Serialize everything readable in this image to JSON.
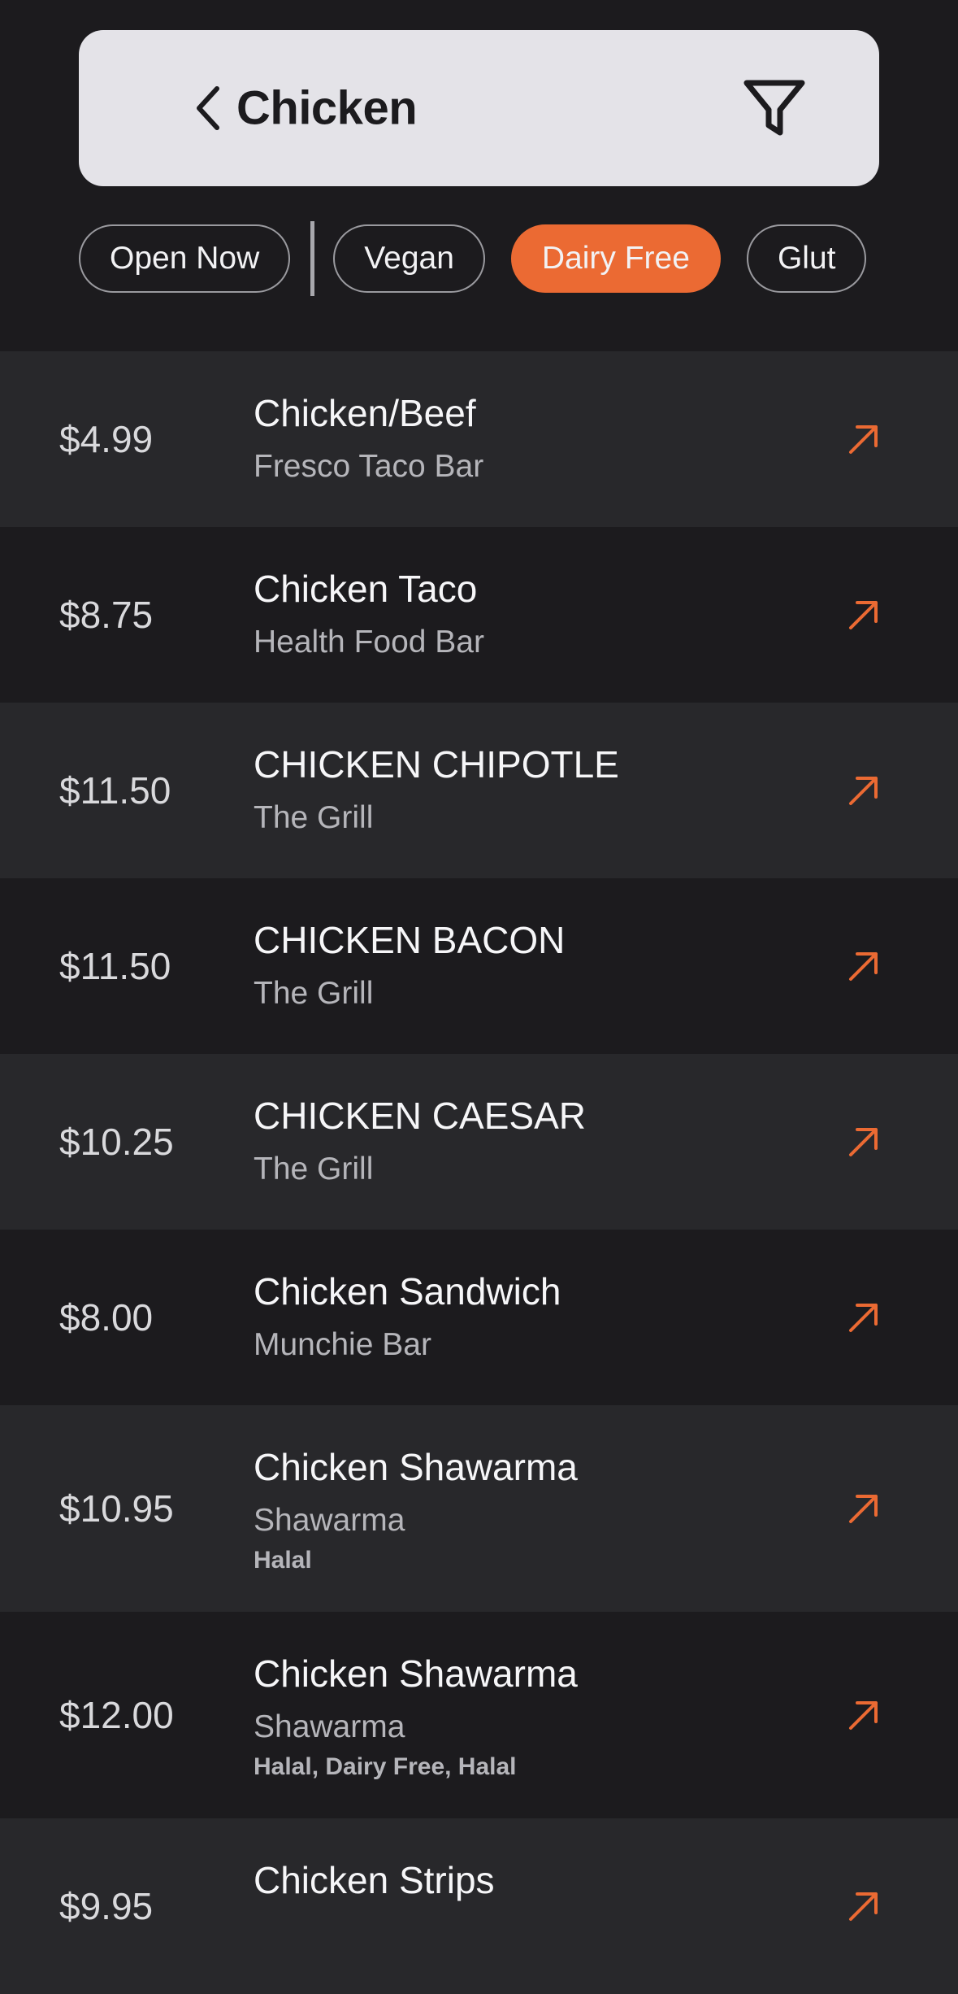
{
  "search": {
    "query": "Chicken",
    "back_icon": "chevron-left-icon",
    "filter_icon": "filter-funnel-icon"
  },
  "colors": {
    "background": "#1c1b1e",
    "row_alt": "#28282b",
    "accent": "#eb6a33",
    "search_bg": "#e4e3e8"
  },
  "filters": [
    {
      "label": "Open Now",
      "selected": false
    },
    {
      "label": "Vegan",
      "selected": false
    },
    {
      "label": "Dairy Free",
      "selected": true
    },
    {
      "label": "Glut",
      "selected": false
    }
  ],
  "items": [
    {
      "price": "$4.99",
      "name": "Chicken/Beef",
      "place": "Fresco Taco Bar",
      "tags": ""
    },
    {
      "price": "$8.75",
      "name": "Chicken Taco",
      "place": "Health Food Bar",
      "tags": ""
    },
    {
      "price": "$11.50",
      "name": "CHICKEN CHIPOTLE",
      "place": "The Grill",
      "tags": ""
    },
    {
      "price": "$11.50",
      "name": "CHICKEN BACON",
      "place": "The Grill",
      "tags": ""
    },
    {
      "price": "$10.25",
      "name": "CHICKEN CAESAR",
      "place": "The Grill",
      "tags": ""
    },
    {
      "price": "$8.00",
      "name": "Chicken Sandwich",
      "place": "Munchie Bar",
      "tags": ""
    },
    {
      "price": "$10.95",
      "name": "Chicken Shawarma",
      "place": "Shawarma",
      "tags": "Halal"
    },
    {
      "price": "$12.00",
      "name": "Chicken Shawarma",
      "place": "Shawarma",
      "tags": "Halal, Dairy Free, Halal"
    },
    {
      "price": "$9.95",
      "name": "Chicken Strips",
      "place": "",
      "tags": ""
    }
  ]
}
